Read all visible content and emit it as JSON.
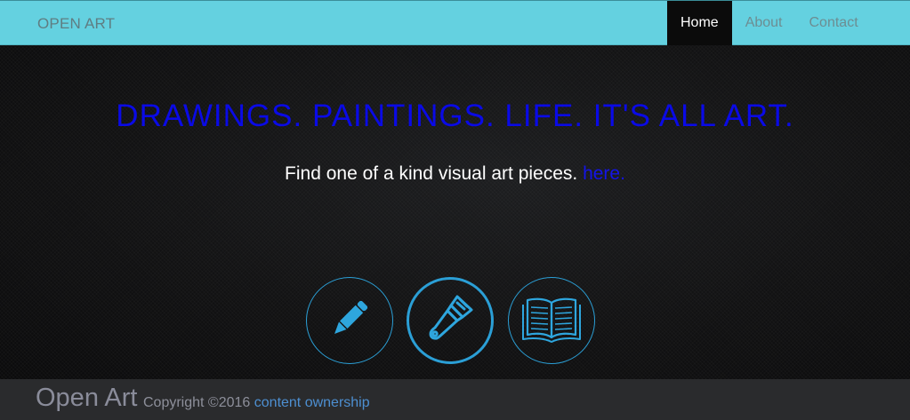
{
  "navbar": {
    "brand": "OPEN ART",
    "links": [
      {
        "label": "Home",
        "active": true
      },
      {
        "label": "About",
        "active": false
      },
      {
        "label": "Contact",
        "active": false
      }
    ]
  },
  "hero": {
    "headline": "DRAWINGS. PAINTINGS. LIFE. IT'S ALL ART.",
    "subline_text": "Find one of a kind visual art pieces.",
    "subline_link": "here."
  },
  "features": [
    {
      "icon": "pencil-icon"
    },
    {
      "icon": "paintbrush-icon"
    },
    {
      "icon": "open-book-icon"
    }
  ],
  "footer": {
    "brand": "Open Art",
    "copyright": "Copyright ©2016",
    "link": "content ownership"
  },
  "colors": {
    "navbar": "#64d1e0",
    "headline": "#0a0ae6",
    "icon_accent": "#2b9fd6",
    "footer": "#2a2b2d"
  }
}
